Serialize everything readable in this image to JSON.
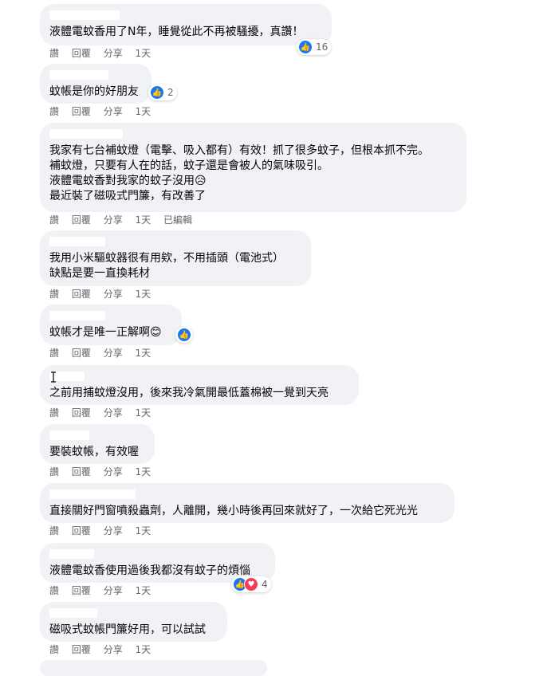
{
  "actions": {
    "like": "讚",
    "reply": "回覆",
    "share": "分享",
    "time": "1天",
    "edited": "已編輯"
  },
  "comments": [
    {
      "text": "液體電蚊香用了N年，睡覺從此不再被騷擾，真讚！",
      "reaction_count": "16"
    },
    {
      "text": "蚊帳是你的好朋友",
      "reaction_count": "2"
    },
    {
      "text": "我家有七台補蚊燈（電擊、吸入都有）有效！抓了很多蚊子，但根本抓不完。\n補蚊燈，只要有人在的話，蚊子還是會被人的氣味吸引。\n液體電蚊香對我家的蚊子沒用😥\n最近裝了磁吸式門簾，有改善了"
    },
    {
      "text": "我用小米驅蚊器很有用欸，不用插頭（電池式）\n缺點是要一直換耗材"
    },
    {
      "text": "蚊帳才是唯一正解啊😊"
    },
    {
      "text": "之前用捕蚊燈沒用，後來我冷氣開最低蓋棉被一覺到天亮"
    },
    {
      "text": "要裝蚊帳，有效喔"
    },
    {
      "text": "直接關好門窗噴殺蟲劑，人離開，幾小時後再回來就好了，一次給它死光光"
    },
    {
      "text": "液體電蚊香使用過後我都沒有蚊子的煩惱",
      "reaction_count": "4"
    },
    {
      "text": "磁吸式蚊帳門簾好用，可以試試"
    }
  ],
  "icons": {
    "like": "like-icon",
    "love": "love-icon"
  },
  "colors": {
    "bubble": "#f0f2f5",
    "like": "#1877f2",
    "love": "#f33e58",
    "meta": "#65676b"
  }
}
